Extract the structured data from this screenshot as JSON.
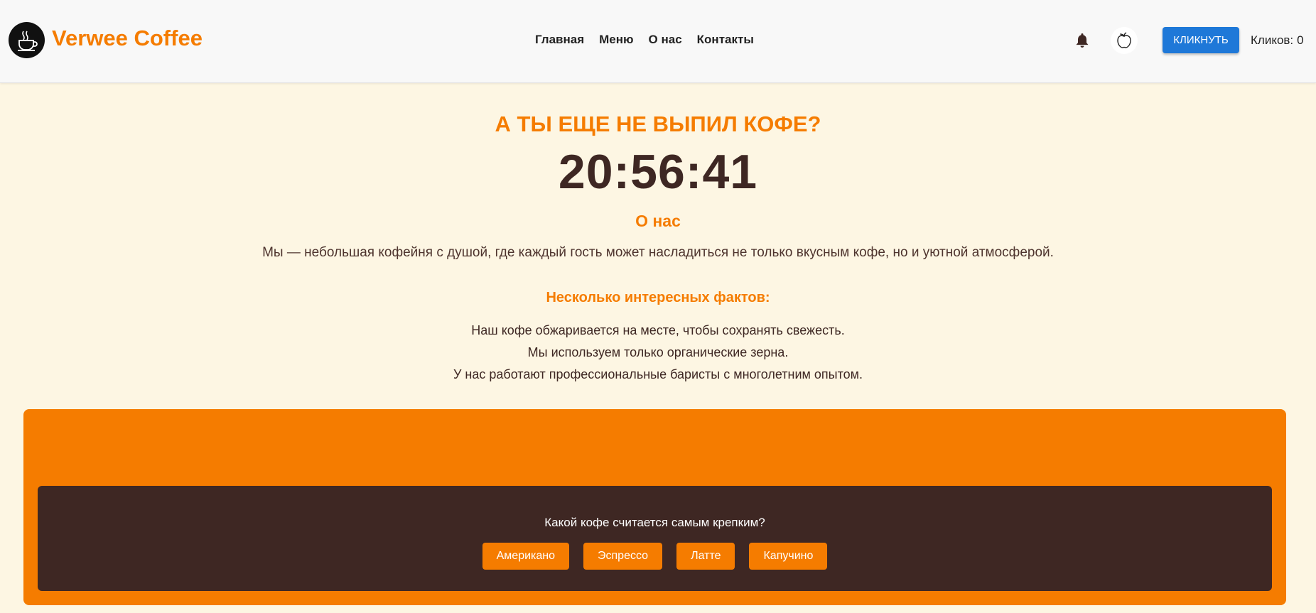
{
  "header": {
    "brand": "Verwee Coffee",
    "nav": [
      "Главная",
      "Меню",
      "О нас",
      "Контакты"
    ],
    "click_button": "КЛИКНУТЬ",
    "clicks_label": "Кликов:",
    "clicks_count": "0",
    "icons": {
      "logo": "coffee-cup-icon",
      "bell": "bell-icon",
      "theme": "apple-icon"
    }
  },
  "main": {
    "promo": "А ТЫ ЕЩЕ НЕ ВЫПИЛ КОФЕ?",
    "clock": "20:56:41",
    "about_title": "О нас",
    "about_text": "Мы — небольшая кофейня с душой, где каждый гость может насладиться не только вкусным кофе, но и уютной атмосферой.",
    "facts_title": "Несколько интересных фактов:",
    "facts": [
      "Наш кофе обжаривается на месте, чтобы сохранять свежесть.",
      "Мы используем только органические зерна.",
      "У нас работают профессиональные баристы с многолетним опытом."
    ]
  },
  "quiz": {
    "question": "Какой кофе считается самым крепким?",
    "answers": [
      "Американо",
      "Эспрессо",
      "Латте",
      "Капучино"
    ]
  },
  "colors": {
    "accent": "#f57c00",
    "dark": "#3e2723",
    "primary": "#1e78d8",
    "background": "#fdf6e3"
  }
}
